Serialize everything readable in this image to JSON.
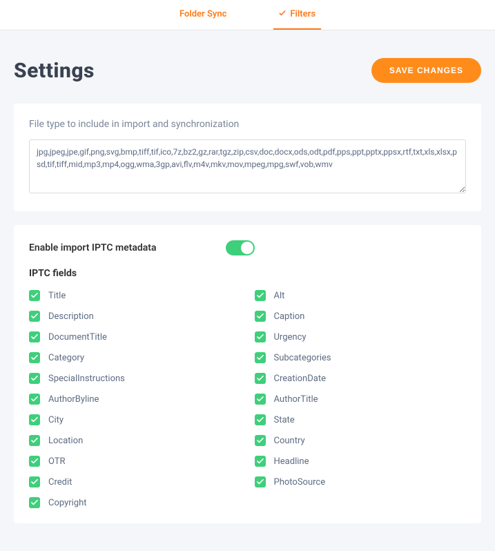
{
  "tabs": {
    "folder_sync": "Folder Sync",
    "filters": "Filters"
  },
  "page_title": "Settings",
  "save_button": "SAVE CHANGES",
  "filetype_label": "File type to include in import and synchronization",
  "filetype_value": "jpg,jpeg,jpe,gif,png,svg,bmp,tiff,tif,ico,7z,bz2,gz,rar,tgz,zip,csv,doc,docx,ods,odt,pdf,pps,ppt,pptx,ppsx,rtf,txt,xls,xlsx,psd,tif,tiff,mid,mp3,mp4,ogg,wma,3gp,avi,flv,m4v,mkv,mov,mpeg,mpg,swf,vob,wmv",
  "iptc_toggle_label": "Enable import IPTC metadata",
  "iptc_section_label": "IPTC fields",
  "iptc_fields_left": [
    "Title",
    "Description",
    "DocumentTitle",
    "Category",
    "SpecialInstructions",
    "AuthorByline",
    "City",
    "Location",
    "OTR",
    "Credit",
    "Copyright"
  ],
  "iptc_fields_right": [
    "Alt",
    "Caption",
    "Urgency",
    "Subcategories",
    "CreationDate",
    "AuthorTitle",
    "State",
    "Country",
    "Headline",
    "PhotoSource"
  ]
}
